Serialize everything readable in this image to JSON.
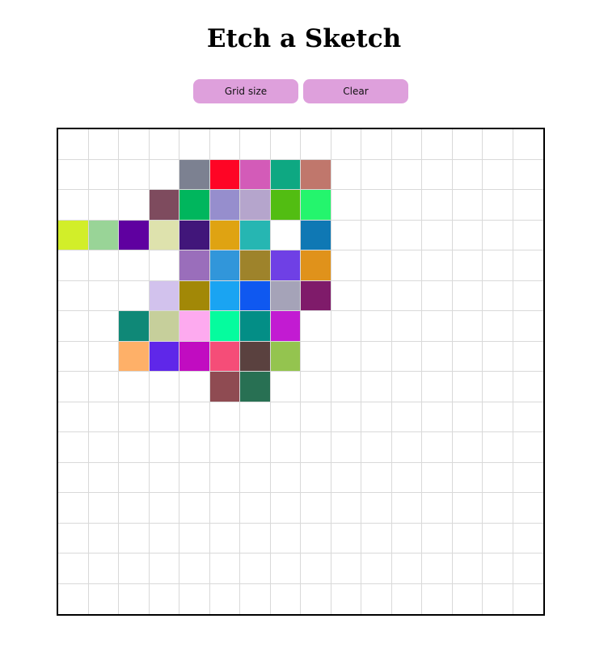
{
  "title": "Etch a Sketch",
  "controls": {
    "grid_size_label": "Grid size",
    "clear_label": "Clear"
  },
  "grid": {
    "size": 16,
    "background": "#ffffff",
    "line_color": "#d9d9d9",
    "cells": [
      {
        "row": 1,
        "col": 4,
        "color": "#7c8191"
      },
      {
        "row": 1,
        "col": 5,
        "color": "#fe0525"
      },
      {
        "row": 1,
        "col": 6,
        "color": "#d35bb8"
      },
      {
        "row": 1,
        "col": 7,
        "color": "#0ea882"
      },
      {
        "row": 1,
        "col": 8,
        "color": "#c0776c"
      },
      {
        "row": 2,
        "col": 3,
        "color": "#7e4b5e"
      },
      {
        "row": 2,
        "col": 4,
        "color": "#00b65d"
      },
      {
        "row": 2,
        "col": 5,
        "color": "#968ecd"
      },
      {
        "row": 2,
        "col": 6,
        "color": "#b5a5cc"
      },
      {
        "row": 2,
        "col": 7,
        "color": "#52bd12"
      },
      {
        "row": 2,
        "col": 8,
        "color": "#24f56d"
      },
      {
        "row": 3,
        "col": 0,
        "color": "#d2ee29"
      },
      {
        "row": 3,
        "col": 1,
        "color": "#99d497"
      },
      {
        "row": 3,
        "col": 2,
        "color": "#5f00a0"
      },
      {
        "row": 3,
        "col": 3,
        "color": "#dee2ad"
      },
      {
        "row": 3,
        "col": 4,
        "color": "#41167a"
      },
      {
        "row": 3,
        "col": 5,
        "color": "#dfa312"
      },
      {
        "row": 3,
        "col": 6,
        "color": "#26b6b2"
      },
      {
        "row": 3,
        "col": 8,
        "color": "#0f78b4"
      },
      {
        "row": 4,
        "col": 4,
        "color": "#9a6ebb"
      },
      {
        "row": 4,
        "col": 5,
        "color": "#3196da"
      },
      {
        "row": 4,
        "col": 6,
        "color": "#9e832b"
      },
      {
        "row": 4,
        "col": 7,
        "color": "#6f40e5"
      },
      {
        "row": 4,
        "col": 8,
        "color": "#e0921b"
      },
      {
        "row": 5,
        "col": 3,
        "color": "#d2c2ed"
      },
      {
        "row": 5,
        "col": 4,
        "color": "#a28807"
      },
      {
        "row": 5,
        "col": 5,
        "color": "#1aa4f2"
      },
      {
        "row": 5,
        "col": 6,
        "color": "#0f58f0"
      },
      {
        "row": 5,
        "col": 7,
        "color": "#a5a3b8"
      },
      {
        "row": 5,
        "col": 8,
        "color": "#7f1b6a"
      },
      {
        "row": 6,
        "col": 2,
        "color": "#0f8877"
      },
      {
        "row": 6,
        "col": 3,
        "color": "#c6cf9b"
      },
      {
        "row": 6,
        "col": 4,
        "color": "#fdaaef"
      },
      {
        "row": 6,
        "col": 5,
        "color": "#05fc9e"
      },
      {
        "row": 6,
        "col": 6,
        "color": "#038e86"
      },
      {
        "row": 6,
        "col": 7,
        "color": "#c21bd2"
      },
      {
        "row": 7,
        "col": 2,
        "color": "#feb068"
      },
      {
        "row": 7,
        "col": 3,
        "color": "#5f27e9"
      },
      {
        "row": 7,
        "col": 4,
        "color": "#c10cc1"
      },
      {
        "row": 7,
        "col": 5,
        "color": "#f54d78"
      },
      {
        "row": 7,
        "col": 6,
        "color": "#5a413f"
      },
      {
        "row": 7,
        "col": 7,
        "color": "#94c44f"
      },
      {
        "row": 8,
        "col": 5,
        "color": "#8f4b52"
      },
      {
        "row": 8,
        "col": 6,
        "color": "#287053"
      }
    ]
  }
}
